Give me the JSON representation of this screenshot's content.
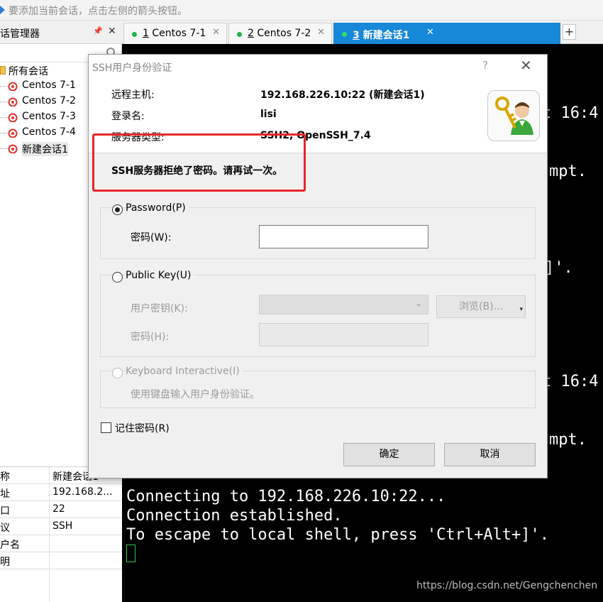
{
  "hint_bar": {
    "text": "要添加当前会话，点击左侧的箭头按钮。"
  },
  "session_manager": {
    "title": "话管理器",
    "pin_glyph": "📌",
    "close_glyph": "✕",
    "folder": "所有会话",
    "sessions": [
      "Centos 7-1",
      "Centos 7-2",
      "Centos 7-3",
      "Centos 7-4",
      "新建会话1"
    ],
    "properties": [
      {
        "k": "称",
        "v": "新建会话1"
      },
      {
        "k": "址",
        "v": "192.168.2..."
      },
      {
        "k": "口",
        "v": "22"
      },
      {
        "k": "议",
        "v": "SSH"
      },
      {
        "k": "户名",
        "v": ""
      },
      {
        "k": "明",
        "v": ""
      }
    ]
  },
  "tabs": [
    {
      "num": "1",
      "label": "Centos 7-1",
      "active": false
    },
    {
      "num": "2",
      "label": "Centos 7-2",
      "active": false
    },
    {
      "num": "3",
      "label": "新建会话1",
      "active": true
    }
  ],
  "new_tab_glyph": "+",
  "terminal": {
    "partial_lines": [
      "t 16:4",
      "mpt.",
      "]'.",
      "t 16:4",
      "mpt."
    ],
    "lines": [
      "Connecting to 192.168.226.10:22...",
      "Connection established.",
      "To escape to local shell, press 'Ctrl+Alt+]'."
    ],
    "watermark": "https://blog.csdn.net/Gengchenchen"
  },
  "dialog": {
    "title": "SSH用户身份验证",
    "help_glyph": "?",
    "close_glyph": "✕",
    "remote_host_label": "远程主机:",
    "remote_host_value": "192.168.226.10:22 (新建会话1)",
    "login_label": "登录名:",
    "login_value": "lisi",
    "server_type_label": "服务器类型:",
    "server_type_value": "SSH2, OpenSSH_7.4",
    "error": "SSH服务器拒绝了密码。请再试一次。",
    "password_option": "Password(P)",
    "password_field_label": "密码(W):",
    "password_value": "",
    "pubkey_option": "Public Key(U)",
    "user_key_label": "用户密钥(K):",
    "browse_button": "浏览(B)...",
    "pubkey_password_label": "密码(H):",
    "keyboard_option": "Keyboard Interactive(I)",
    "keyboard_desc": "使用键盘输入用户身份验证。",
    "remember_password": "记住密码(R)",
    "ok_button": "确定",
    "cancel_button": "取消",
    "selected_method": "Password"
  },
  "colors": {
    "active_tab": "#1787d8",
    "highlight_box": "#e8262a",
    "terminal_bg": "#000000",
    "cursor": "#25d048"
  }
}
